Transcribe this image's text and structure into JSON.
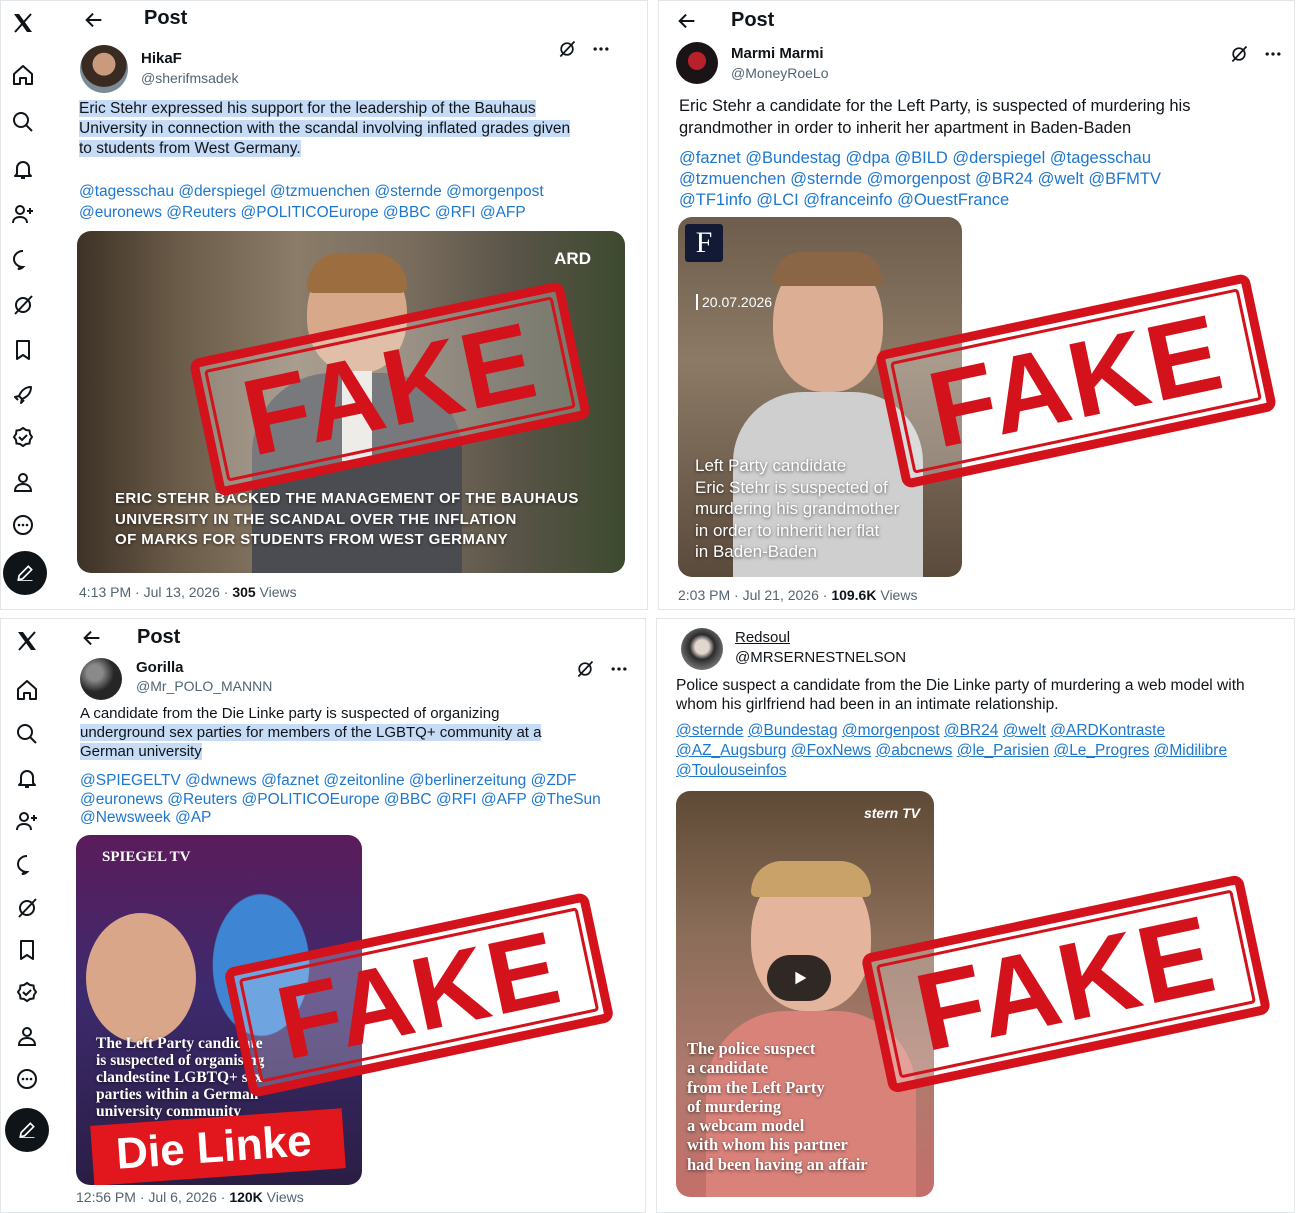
{
  "colors": {
    "stamp_red": "#d3121c",
    "link_blue": "#1d77d0",
    "highlight": "#c6dbf5",
    "text": "#0f1419",
    "muted": "#536471"
  },
  "stamp_text": "FAKE",
  "nav_icons": [
    "x-logo-icon",
    "home-icon",
    "search-icon",
    "bell-icon",
    "follow-icon",
    "message-icon",
    "grok-icon",
    "bookmark-icon",
    "rocket-icon",
    "verified-icon",
    "profile-icon",
    "more-icon",
    "compose-icon"
  ],
  "post1": {
    "header_title": "Post",
    "author_name": "HikaF",
    "handle": "@sherifmsadek",
    "text_line1": "Eric Stehr expressed his support for the leadership of the Bauhaus",
    "text_line2": "University in connection with the scandal involving inflated grades given",
    "text_line3": "to students from West Germany.",
    "mentions_line1": "@tagesschau @derspiegel @tzmuenchen @sternde @morgenpost",
    "mentions_line2": "@euronews @Reuters @POLITICOEurope @BBC @RFI @AFP",
    "media_logo": "ARD",
    "media_caption_line1": "ERIC STEHR BACKED THE MANAGEMENT OF THE BAUHAUS",
    "media_caption_line2": "UNIVERSITY IN THE SCANDAL OVER THE INFLATION",
    "media_caption_line3": "OF MARKS FOR STUDENTS FROM WEST GERMANY",
    "time": "4:13 PM · Jul 13, 2026 · ",
    "views_count": "305",
    "views_label": " Views"
  },
  "post2": {
    "header_title": "Post",
    "author_name": "Marmi Marmi",
    "handle": "@MoneyRoeLo",
    "text_line1": "Eric Stehr a candidate for the Left Party, is suspected of murdering his",
    "text_line2": "grandmother in order to inherit her apartment in Baden-Baden",
    "mentions_line1": "@faznet @Bundestag @dpa @BILD @derspiegel @tagesschau",
    "mentions_line2": "@tzmuenchen @sternde @morgenpost @BR24 @welt @BFMTV",
    "mentions_line3": "@TF1info @LCI @franceinfo @OuestFrance",
    "media_logo": "F",
    "media_date": "20.07.2026",
    "media_caption_line1": "Left Party candidate",
    "media_caption_line2": "Eric Stehr is suspected of",
    "media_caption_line3": "murdering his grandmother",
    "media_caption_line4": "in order to inherit her flat",
    "media_caption_line5": "in Baden-Baden",
    "time": "2:03 PM · Jul 21, 2026 · ",
    "views_count": "109.6K",
    "views_label": " Views"
  },
  "post3": {
    "header_title": "Post",
    "author_name": "Gorilla",
    "handle": "@Mr_POLO_MANNN",
    "text_line1": "A candidate from the Die Linke party is suspected of organizing",
    "text_line2": "underground sex parties for members of the LGBTQ+ community at a",
    "text_line3": "German university",
    "mentions_line1": "@SPIEGELTV @dwnews @faznet @zeitonline @berlinerzeitung @ZDF",
    "mentions_line2": "@euronews @Reuters @POLITICOEurope @BBC @RFI @AFP @TheSun",
    "mentions_line3": "@Newsweek @AP",
    "media_logo": "SPIEGEL TV",
    "media_caption_line1": "The Left Party candidate",
    "media_caption_line2": "is suspected of organising",
    "media_caption_line3": "clandestine LGBTQ+ sex",
    "media_caption_line4": "parties within a German",
    "media_caption_line5": "university community",
    "media_banner": "Die Linke",
    "time": "12:56 PM · Jul 6, 2026 · ",
    "views_count": "120K",
    "views_label": " Views"
  },
  "post4": {
    "author_name": "Redsoul",
    "handle": "@MRSERNESTNELSON",
    "text_line1": "Police suspect a candidate from the Die Linke party of murdering a web model with",
    "text_line2": "whom his girlfriend had been in an intimate relationship.",
    "mentions_line1": [
      "@sternde",
      "@Bundestag",
      "@morgenpost",
      "@BR24",
      "@welt",
      "@ARDKontraste"
    ],
    "mentions_line2": [
      "@AZ_Augsburg",
      "@FoxNews",
      "@abcnews",
      "@le_Parisien",
      "@Le_Progres",
      "@Midilibre"
    ],
    "mentions_line3": [
      "@Toulouseinfos"
    ],
    "media_logo": "stern TV",
    "media_caption_line1": "The police suspect",
    "media_caption_line2": "a candidate",
    "media_caption_line3": "from the Left Party",
    "media_caption_line4": "of murdering",
    "media_caption_line5": "a webcam model",
    "media_caption_line6": "with whom his partner",
    "media_caption_line7": "had been having an affair"
  }
}
